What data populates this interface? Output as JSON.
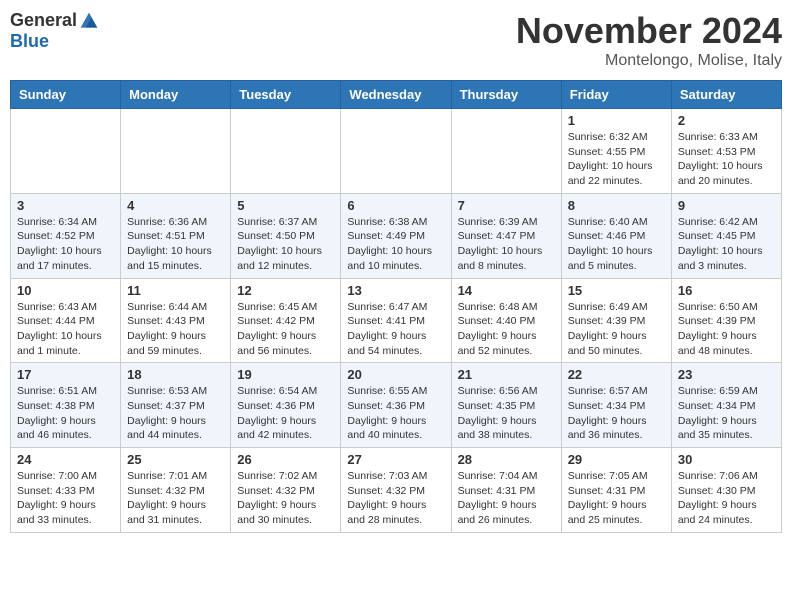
{
  "header": {
    "logo_general": "General",
    "logo_blue": "Blue",
    "month_title": "November 2024",
    "location": "Montelongo, Molise, Italy"
  },
  "weekdays": [
    "Sunday",
    "Monday",
    "Tuesday",
    "Wednesday",
    "Thursday",
    "Friday",
    "Saturday"
  ],
  "weeks": [
    [
      {
        "day": "",
        "info": ""
      },
      {
        "day": "",
        "info": ""
      },
      {
        "day": "",
        "info": ""
      },
      {
        "day": "",
        "info": ""
      },
      {
        "day": "",
        "info": ""
      },
      {
        "day": "1",
        "info": "Sunrise: 6:32 AM\nSunset: 4:55 PM\nDaylight: 10 hours and 22 minutes."
      },
      {
        "day": "2",
        "info": "Sunrise: 6:33 AM\nSunset: 4:53 PM\nDaylight: 10 hours and 20 minutes."
      }
    ],
    [
      {
        "day": "3",
        "info": "Sunrise: 6:34 AM\nSunset: 4:52 PM\nDaylight: 10 hours and 17 minutes."
      },
      {
        "day": "4",
        "info": "Sunrise: 6:36 AM\nSunset: 4:51 PM\nDaylight: 10 hours and 15 minutes."
      },
      {
        "day": "5",
        "info": "Sunrise: 6:37 AM\nSunset: 4:50 PM\nDaylight: 10 hours and 12 minutes."
      },
      {
        "day": "6",
        "info": "Sunrise: 6:38 AM\nSunset: 4:49 PM\nDaylight: 10 hours and 10 minutes."
      },
      {
        "day": "7",
        "info": "Sunrise: 6:39 AM\nSunset: 4:47 PM\nDaylight: 10 hours and 8 minutes."
      },
      {
        "day": "8",
        "info": "Sunrise: 6:40 AM\nSunset: 4:46 PM\nDaylight: 10 hours and 5 minutes."
      },
      {
        "day": "9",
        "info": "Sunrise: 6:42 AM\nSunset: 4:45 PM\nDaylight: 10 hours and 3 minutes."
      }
    ],
    [
      {
        "day": "10",
        "info": "Sunrise: 6:43 AM\nSunset: 4:44 PM\nDaylight: 10 hours and 1 minute."
      },
      {
        "day": "11",
        "info": "Sunrise: 6:44 AM\nSunset: 4:43 PM\nDaylight: 9 hours and 59 minutes."
      },
      {
        "day": "12",
        "info": "Sunrise: 6:45 AM\nSunset: 4:42 PM\nDaylight: 9 hours and 56 minutes."
      },
      {
        "day": "13",
        "info": "Sunrise: 6:47 AM\nSunset: 4:41 PM\nDaylight: 9 hours and 54 minutes."
      },
      {
        "day": "14",
        "info": "Sunrise: 6:48 AM\nSunset: 4:40 PM\nDaylight: 9 hours and 52 minutes."
      },
      {
        "day": "15",
        "info": "Sunrise: 6:49 AM\nSunset: 4:39 PM\nDaylight: 9 hours and 50 minutes."
      },
      {
        "day": "16",
        "info": "Sunrise: 6:50 AM\nSunset: 4:39 PM\nDaylight: 9 hours and 48 minutes."
      }
    ],
    [
      {
        "day": "17",
        "info": "Sunrise: 6:51 AM\nSunset: 4:38 PM\nDaylight: 9 hours and 46 minutes."
      },
      {
        "day": "18",
        "info": "Sunrise: 6:53 AM\nSunset: 4:37 PM\nDaylight: 9 hours and 44 minutes."
      },
      {
        "day": "19",
        "info": "Sunrise: 6:54 AM\nSunset: 4:36 PM\nDaylight: 9 hours and 42 minutes."
      },
      {
        "day": "20",
        "info": "Sunrise: 6:55 AM\nSunset: 4:36 PM\nDaylight: 9 hours and 40 minutes."
      },
      {
        "day": "21",
        "info": "Sunrise: 6:56 AM\nSunset: 4:35 PM\nDaylight: 9 hours and 38 minutes."
      },
      {
        "day": "22",
        "info": "Sunrise: 6:57 AM\nSunset: 4:34 PM\nDaylight: 9 hours and 36 minutes."
      },
      {
        "day": "23",
        "info": "Sunrise: 6:59 AM\nSunset: 4:34 PM\nDaylight: 9 hours and 35 minutes."
      }
    ],
    [
      {
        "day": "24",
        "info": "Sunrise: 7:00 AM\nSunset: 4:33 PM\nDaylight: 9 hours and 33 minutes."
      },
      {
        "day": "25",
        "info": "Sunrise: 7:01 AM\nSunset: 4:32 PM\nDaylight: 9 hours and 31 minutes."
      },
      {
        "day": "26",
        "info": "Sunrise: 7:02 AM\nSunset: 4:32 PM\nDaylight: 9 hours and 30 minutes."
      },
      {
        "day": "27",
        "info": "Sunrise: 7:03 AM\nSunset: 4:32 PM\nDaylight: 9 hours and 28 minutes."
      },
      {
        "day": "28",
        "info": "Sunrise: 7:04 AM\nSunset: 4:31 PM\nDaylight: 9 hours and 26 minutes."
      },
      {
        "day": "29",
        "info": "Sunrise: 7:05 AM\nSunset: 4:31 PM\nDaylight: 9 hours and 25 minutes."
      },
      {
        "day": "30",
        "info": "Sunrise: 7:06 AM\nSunset: 4:30 PM\nDaylight: 9 hours and 24 minutes."
      }
    ]
  ]
}
